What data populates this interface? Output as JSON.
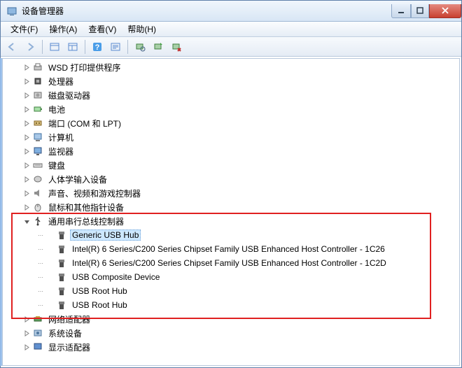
{
  "window": {
    "title": "设备管理器"
  },
  "menu": {
    "file": "文件(F)",
    "action": "操作(A)",
    "view": "查看(V)",
    "help": "帮助(H)"
  },
  "tree": {
    "items": [
      {
        "label": "WSD 打印提供程序",
        "indent": 1,
        "twisty": "closed",
        "icon": "printer"
      },
      {
        "label": "处理器",
        "indent": 1,
        "twisty": "closed",
        "icon": "chip"
      },
      {
        "label": "磁盘驱动器",
        "indent": 1,
        "twisty": "closed",
        "icon": "disk"
      },
      {
        "label": "电池",
        "indent": 1,
        "twisty": "closed",
        "icon": "battery"
      },
      {
        "label": "端口 (COM 和 LPT)",
        "indent": 1,
        "twisty": "closed",
        "icon": "port"
      },
      {
        "label": "计算机",
        "indent": 1,
        "twisty": "closed",
        "icon": "computer"
      },
      {
        "label": "监视器",
        "indent": 1,
        "twisty": "closed",
        "icon": "monitor"
      },
      {
        "label": "键盘",
        "indent": 1,
        "twisty": "closed",
        "icon": "keyboard"
      },
      {
        "label": "人体学输入设备",
        "indent": 1,
        "twisty": "closed",
        "icon": "hid"
      },
      {
        "label": "声音、视频和游戏控制器",
        "indent": 1,
        "twisty": "closed",
        "icon": "sound"
      },
      {
        "label": "鼠标和其他指针设备",
        "indent": 1,
        "twisty": "closed",
        "icon": "mouse"
      },
      {
        "label": "通用串行总线控制器",
        "indent": 1,
        "twisty": "open",
        "icon": "usb-ctrl"
      },
      {
        "label": "Generic USB Hub",
        "indent": 2,
        "twisty": "none",
        "icon": "usb",
        "selected": true
      },
      {
        "label": "Intel(R) 6 Series/C200 Series Chipset Family USB Enhanced Host Controller - 1C26",
        "indent": 2,
        "twisty": "none",
        "icon": "usb"
      },
      {
        "label": "Intel(R) 6 Series/C200 Series Chipset Family USB Enhanced Host Controller - 1C2D",
        "indent": 2,
        "twisty": "none",
        "icon": "usb"
      },
      {
        "label": "USB Composite Device",
        "indent": 2,
        "twisty": "none",
        "icon": "usb"
      },
      {
        "label": "USB Root Hub",
        "indent": 2,
        "twisty": "none",
        "icon": "usb"
      },
      {
        "label": "USB Root Hub",
        "indent": 2,
        "twisty": "none",
        "icon": "usb"
      },
      {
        "label": "网络适配器",
        "indent": 1,
        "twisty": "closed",
        "icon": "network"
      },
      {
        "label": "系统设备",
        "indent": 1,
        "twisty": "closed",
        "icon": "system"
      },
      {
        "label": "显示适配器",
        "indent": 1,
        "twisty": "closed",
        "icon": "display"
      }
    ]
  }
}
